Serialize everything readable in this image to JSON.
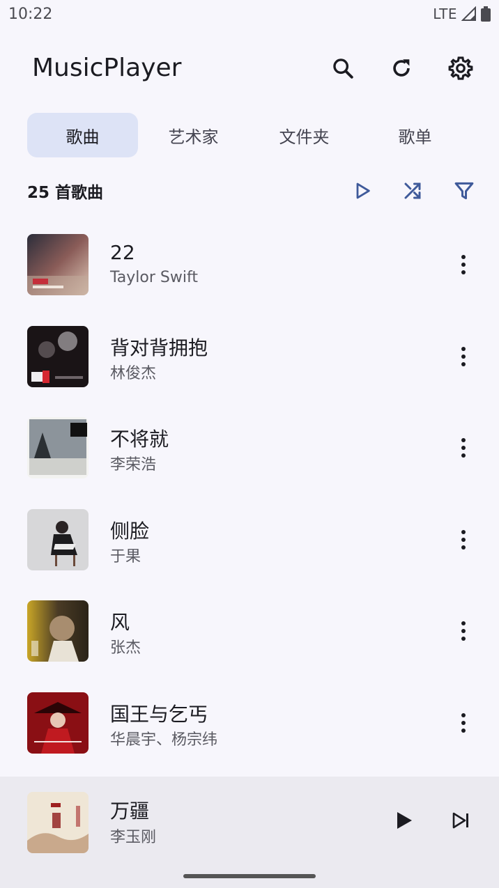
{
  "status_bar": {
    "time": "10:22",
    "network": "LTE"
  },
  "app_bar": {
    "title": "MusicPlayer",
    "actions": [
      "search-icon",
      "refresh-icon",
      "settings-gear-icon"
    ]
  },
  "tabs": [
    {
      "label": "歌曲",
      "active": true
    },
    {
      "label": "艺术家",
      "active": false
    },
    {
      "label": "文件夹",
      "active": false
    },
    {
      "label": "歌单",
      "active": false
    }
  ],
  "list_header": {
    "count_label": "25 首歌曲",
    "actions": [
      "play-icon",
      "shuffle-icon",
      "filter-icon"
    ]
  },
  "songs": [
    {
      "title": "22",
      "artist": "Taylor Swift"
    },
    {
      "title": "背对背拥抱",
      "artist": "林俊杰"
    },
    {
      "title": "不将就",
      "artist": "李荣浩"
    },
    {
      "title": "侧脸",
      "artist": "于果"
    },
    {
      "title": "风",
      "artist": "张杰"
    },
    {
      "title": "国王与乞丐",
      "artist": "华晨宇、杨宗纬"
    }
  ],
  "now_playing": {
    "title": "万疆",
    "artist": "李玉刚"
  },
  "colors": {
    "accent": "#3f5a9a",
    "tab_active_bg": "#dde3f6",
    "background": "#f7f6fc",
    "player_bg": "#ebeaf0"
  }
}
